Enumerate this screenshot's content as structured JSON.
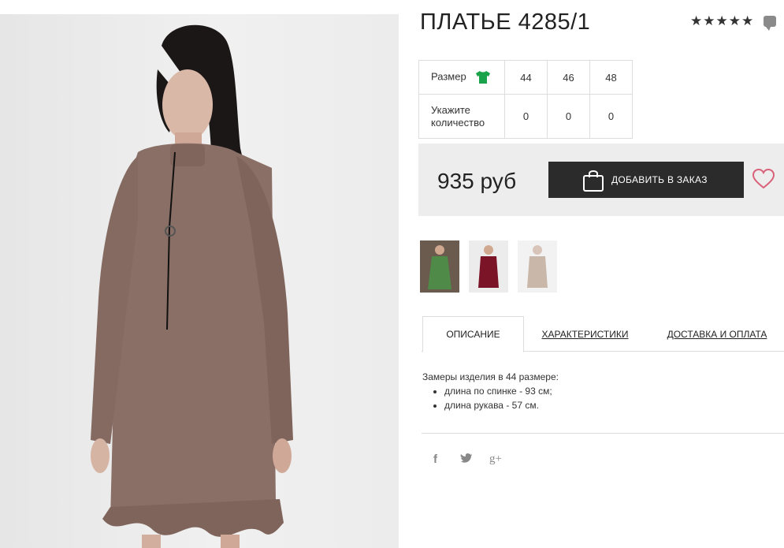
{
  "product": {
    "title": "ПЛАТЬЕ 4285/1",
    "rating_stars": 5,
    "price": "935 руб",
    "add_button_label": "ДОБАВИТЬ В ЗАКАЗ"
  },
  "size_table": {
    "row_size_label": "Размер",
    "row_qty_label": "Укажите количество",
    "sizes": [
      "44",
      "46",
      "48"
    ],
    "quantities": [
      "0",
      "0",
      "0"
    ]
  },
  "thumbnails": [
    {
      "color_name": "green",
      "color": "#4f8a48"
    },
    {
      "color_name": "burgundy",
      "color": "#7a1426"
    },
    {
      "color_name": "beige",
      "color": "#c9b7aa"
    }
  ],
  "tabs": {
    "description": "ОПИСАНИЕ",
    "characteristics": "ХАРАКТЕРИСТИКИ",
    "delivery": "ДОСТАВКА И ОПЛАТА"
  },
  "description": {
    "intro": "Замеры изделия в 44 размере:",
    "items": [
      "длина по спинке - 93 см;",
      "длина рукава - 57 см."
    ]
  },
  "social": {
    "facebook": "f",
    "twitter": "🐦",
    "googleplus": "g+"
  },
  "colors": {
    "dress": "#8a6f66",
    "accent_green": "#1aa34a",
    "heart": "#d9617a",
    "button_bg": "#2b2b2b"
  }
}
